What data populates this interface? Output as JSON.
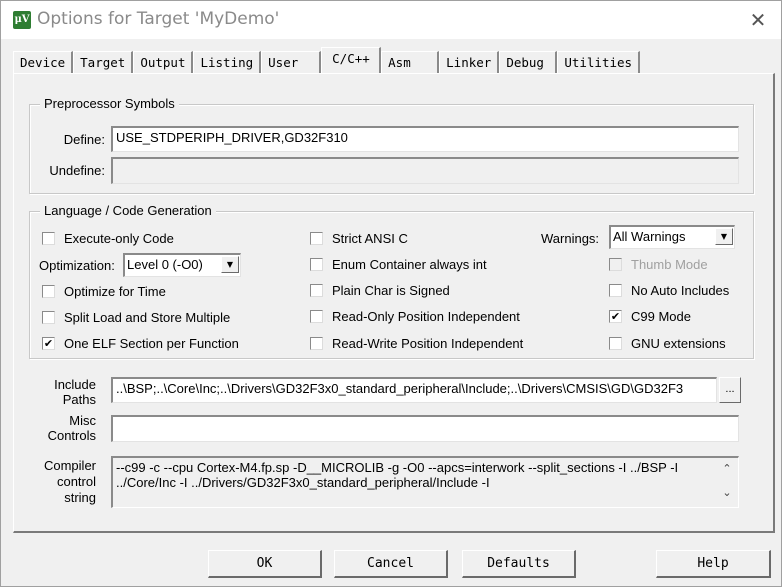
{
  "window": {
    "title": "Options for Target 'MyDemo'",
    "app_icon": "keil-uvision-icon",
    "close_glyph": "✕"
  },
  "tabs": [
    {
      "label": "Device",
      "active": false
    },
    {
      "label": "Target",
      "active": false
    },
    {
      "label": "Output",
      "active": false
    },
    {
      "label": "Listing",
      "active": false
    },
    {
      "label": "User",
      "active": false
    },
    {
      "label": "C/C++",
      "active": true
    },
    {
      "label": "Asm",
      "active": false
    },
    {
      "label": "Linker",
      "active": false
    },
    {
      "label": "Debug",
      "active": false
    },
    {
      "label": "Utilities",
      "active": false
    }
  ],
  "preprocessor": {
    "group_label": "Preprocessor Symbols",
    "define_label": "Define:",
    "define_value": "USE_STDPERIPH_DRIVER,GD32F310",
    "undefine_label": "Undefine:",
    "undefine_value": ""
  },
  "language": {
    "group_label": "Language / Code Generation",
    "execute_only": {
      "label": "Execute-only Code",
      "checked": false
    },
    "optimization_label": "Optimization:",
    "optimization_value": "Level 0 (-O0)",
    "optimize_time": {
      "label": "Optimize for Time",
      "checked": false
    },
    "split_load": {
      "label": "Split Load and Store Multiple",
      "checked": false
    },
    "one_elf": {
      "label": "One ELF Section per Function",
      "checked": true
    },
    "strict_ansi": {
      "label": "Strict ANSI C",
      "checked": false
    },
    "enum_container": {
      "label": "Enum Container always int",
      "checked": false
    },
    "plain_char": {
      "label": "Plain Char is Signed",
      "checked": false
    },
    "ro_pi": {
      "label": "Read-Only Position Independent",
      "checked": false
    },
    "rw_pi": {
      "label": "Read-Write Position Independent",
      "checked": false
    },
    "warnings_label": "Warnings:",
    "warnings_value": "All Warnings",
    "thumb_mode": {
      "label": "Thumb Mode",
      "checked": false,
      "disabled": true
    },
    "no_auto_includes": {
      "label": "No Auto Includes",
      "checked": false
    },
    "c99_mode": {
      "label": "C99 Mode",
      "checked": true
    },
    "gnu_extensions": {
      "label": "GNU extensions",
      "checked": false
    }
  },
  "include_paths": {
    "label_line1": "Include",
    "label_line2": "Paths",
    "value": "..\\BSP;..\\Core\\Inc;..\\Drivers\\GD32F3x0_standard_peripheral\\Include;..\\Drivers\\CMSIS\\GD\\GD32F3",
    "browse_label": "..."
  },
  "misc_controls": {
    "label_line1": "Misc",
    "label_line2": "Controls",
    "value": ""
  },
  "compiler_string": {
    "label_line1": "Compiler",
    "label_line2": "control",
    "label_line3": "string",
    "line1": "--c99 -c --cpu Cortex-M4.fp.sp -D__MICROLIB -g -O0 --apcs=interwork --split_sections -I ../BSP -I",
    "line2": "../Core/Inc -I ../Drivers/GD32F3x0_standard_peripheral/Include -I",
    "scroll_up": "⌃",
    "scroll_down": "⌄"
  },
  "buttons": {
    "ok": "OK",
    "cancel": "Cancel",
    "defaults": "Defaults",
    "help": "Help"
  },
  "checkmark": "✔"
}
